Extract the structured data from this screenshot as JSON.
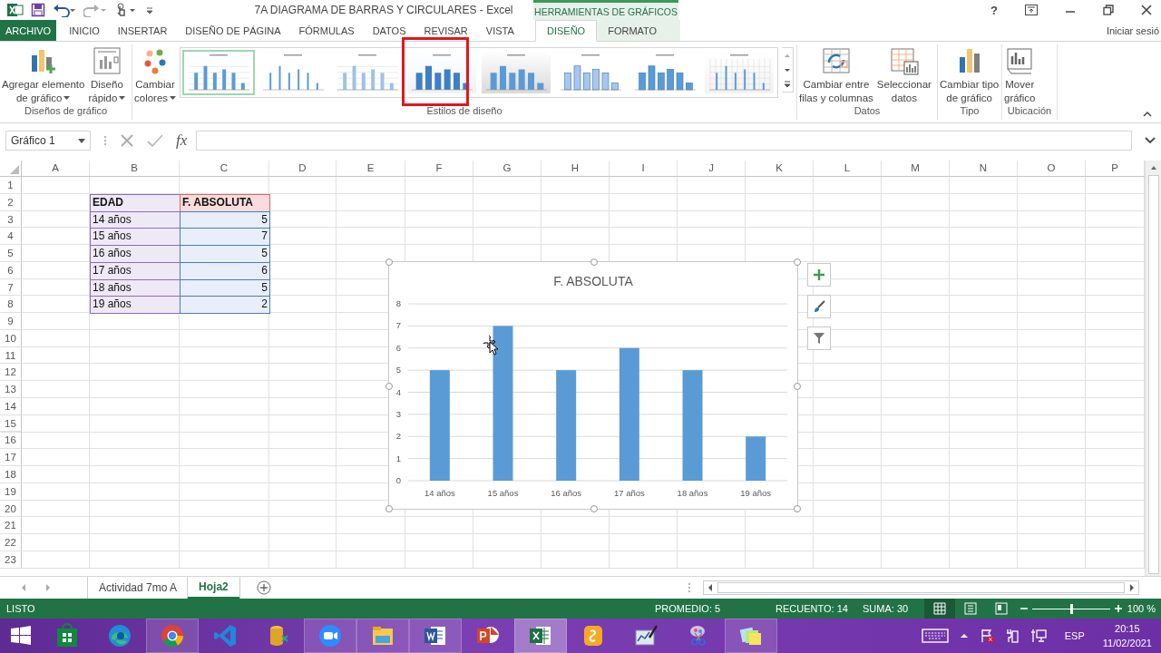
{
  "window": {
    "title": "7A DIAGRAMA DE BARRAS Y CIRCULARES - Excel",
    "context_group": "HERRAMIENTAS DE GRÁFICOS",
    "help": "?",
    "account": "Iniciar sesió"
  },
  "ribbon_tabs": [
    {
      "label": "ARCHIVO",
      "kind": "file",
      "selected": false
    },
    {
      "label": "INICIO",
      "kind": "main",
      "selected": false
    },
    {
      "label": "INSERTAR",
      "kind": "main",
      "selected": false
    },
    {
      "label": "DISEÑO DE PÁGINA",
      "kind": "main",
      "selected": false
    },
    {
      "label": "FÓRMULAS",
      "kind": "main",
      "selected": false
    },
    {
      "label": "DATOS",
      "kind": "main",
      "selected": false
    },
    {
      "label": "REVISAR",
      "kind": "main",
      "selected": false
    },
    {
      "label": "VISTA",
      "kind": "main",
      "selected": false
    },
    {
      "label": "DISEÑO",
      "kind": "context",
      "selected": true
    },
    {
      "label": "FORMATO",
      "kind": "context",
      "selected": false
    }
  ],
  "ribbon_groups": [
    {
      "label": "Diseños de gráfico",
      "commands": [
        {
          "kind": "add-element",
          "lines": [
            "Agregar elemento",
            "de gráfico"
          ],
          "dropdown": true
        },
        {
          "kind": "quick-layout",
          "lines": [
            "Diseño",
            "rápido"
          ],
          "dropdown": true
        }
      ]
    },
    {
      "label": "Estilos de diseño",
      "commands": [
        {
          "kind": "colors",
          "lines": [
            "Cambiar",
            "colores"
          ],
          "dropdown": true
        }
      ],
      "gallery": [
        {
          "kind": "plain",
          "selected": true,
          "highlighted": false
        },
        {
          "kind": "thin",
          "selected": false,
          "highlighted": false
        },
        {
          "kind": "striped",
          "selected": false,
          "highlighted": false
        },
        {
          "kind": "gradient",
          "selected": false,
          "highlighted": true
        },
        {
          "kind": "shaded",
          "selected": false,
          "highlighted": false
        },
        {
          "kind": "light",
          "selected": false,
          "highlighted": false
        },
        {
          "kind": "raised",
          "selected": false,
          "highlighted": false
        },
        {
          "kind": "hatched",
          "selected": false,
          "highlighted": false
        }
      ]
    },
    {
      "label": "Datos",
      "commands": [
        {
          "kind": "switch",
          "lines": [
            "Cambiar entre",
            "filas y columnas"
          ],
          "dropdown": false
        },
        {
          "kind": "select-data",
          "lines": [
            "Seleccionar",
            "datos"
          ],
          "dropdown": false
        }
      ]
    },
    {
      "label": "Tipo",
      "commands": [
        {
          "kind": "chart-type",
          "lines": [
            "Cambiar tipo",
            "de gráfico"
          ],
          "dropdown": false
        }
      ]
    },
    {
      "label": "Ubicación",
      "commands": [
        {
          "kind": "move",
          "lines": [
            "Mover",
            "gráfico"
          ],
          "dropdown": false
        }
      ]
    }
  ],
  "formula_bar": {
    "name_box": "Gráfico 1",
    "function_label": "fx"
  },
  "sheet": {
    "columns": [
      "A",
      "B",
      "C",
      "D",
      "E",
      "F",
      "G",
      "H",
      "I",
      "J",
      "K",
      "L",
      "M",
      "N",
      "O",
      "P"
    ],
    "rows": [
      "1",
      "2",
      "3",
      "4",
      "5",
      "6",
      "7",
      "8",
      "9",
      "10",
      "11",
      "12",
      "13",
      "14",
      "15",
      "16",
      "17",
      "18",
      "19",
      "20",
      "21",
      "22",
      "23"
    ],
    "table": {
      "highlighted": true,
      "header": [
        "EDAD",
        "F. ABSOLUTA"
      ],
      "rows": [
        [
          "14 años",
          "5"
        ],
        [
          "15 años",
          "7"
        ],
        [
          "16 años",
          "5"
        ],
        [
          "17 años",
          "6"
        ],
        [
          "18 años",
          "5"
        ],
        [
          "19 años",
          "2"
        ]
      ]
    }
  },
  "chart": {
    "selected": true,
    "chart_data": {
      "type": "bar",
      "title": "F. ABSOLUTA",
      "categories": [
        "14 años",
        "15 años",
        "16 años",
        "17 años",
        "18 años",
        "19 años"
      ],
      "values": [
        5,
        7,
        5,
        6,
        5,
        2
      ],
      "grid": true,
      "ylim": [
        0,
        8
      ],
      "yticks": [
        0,
        1,
        2,
        3,
        4,
        5,
        6,
        7,
        8
      ]
    }
  },
  "sheet_tabs": [
    {
      "label": "Actividad 7mo A",
      "selected": false
    },
    {
      "label": "Hoja2",
      "selected": true
    }
  ],
  "status_bar": {
    "mode": "LISTO",
    "stats": [
      "PROMEDIO: 5",
      "RECUENTO: 14",
      "SUMA: 30"
    ],
    "views": [
      {
        "kind": "normal",
        "selected": true
      },
      {
        "kind": "page-layout",
        "selected": false
      },
      {
        "kind": "page-break",
        "selected": false
      }
    ],
    "zoom": {
      "level": 0.5,
      "label": "100 %"
    }
  },
  "taskbar": {
    "apps": [
      {
        "kind": "start",
        "open": false,
        "selected": false
      },
      {
        "kind": "store",
        "open": false,
        "selected": false
      },
      {
        "kind": "edge",
        "open": false,
        "selected": false
      },
      {
        "kind": "chrome",
        "open": true,
        "selected": false
      },
      {
        "kind": "vscode",
        "open": false,
        "selected": false
      },
      {
        "kind": "database",
        "open": false,
        "selected": false
      },
      {
        "kind": "zoom",
        "open": true,
        "selected": false
      },
      {
        "kind": "explorer",
        "open": true,
        "selected": false
      },
      {
        "kind": "word",
        "open": true,
        "selected": false
      },
      {
        "kind": "powerpoint",
        "open": false,
        "selected": false
      },
      {
        "kind": "excel",
        "open": true,
        "selected": true
      },
      {
        "kind": "scratch",
        "open": false,
        "selected": false
      },
      {
        "kind": "pen",
        "open": false,
        "selected": false
      },
      {
        "kind": "paint",
        "open": false,
        "selected": false
      },
      {
        "kind": "notes",
        "open": true,
        "selected": false
      }
    ],
    "tray": {
      "language": "ESP",
      "time": "20:15",
      "date": "11/02/2021"
    }
  }
}
